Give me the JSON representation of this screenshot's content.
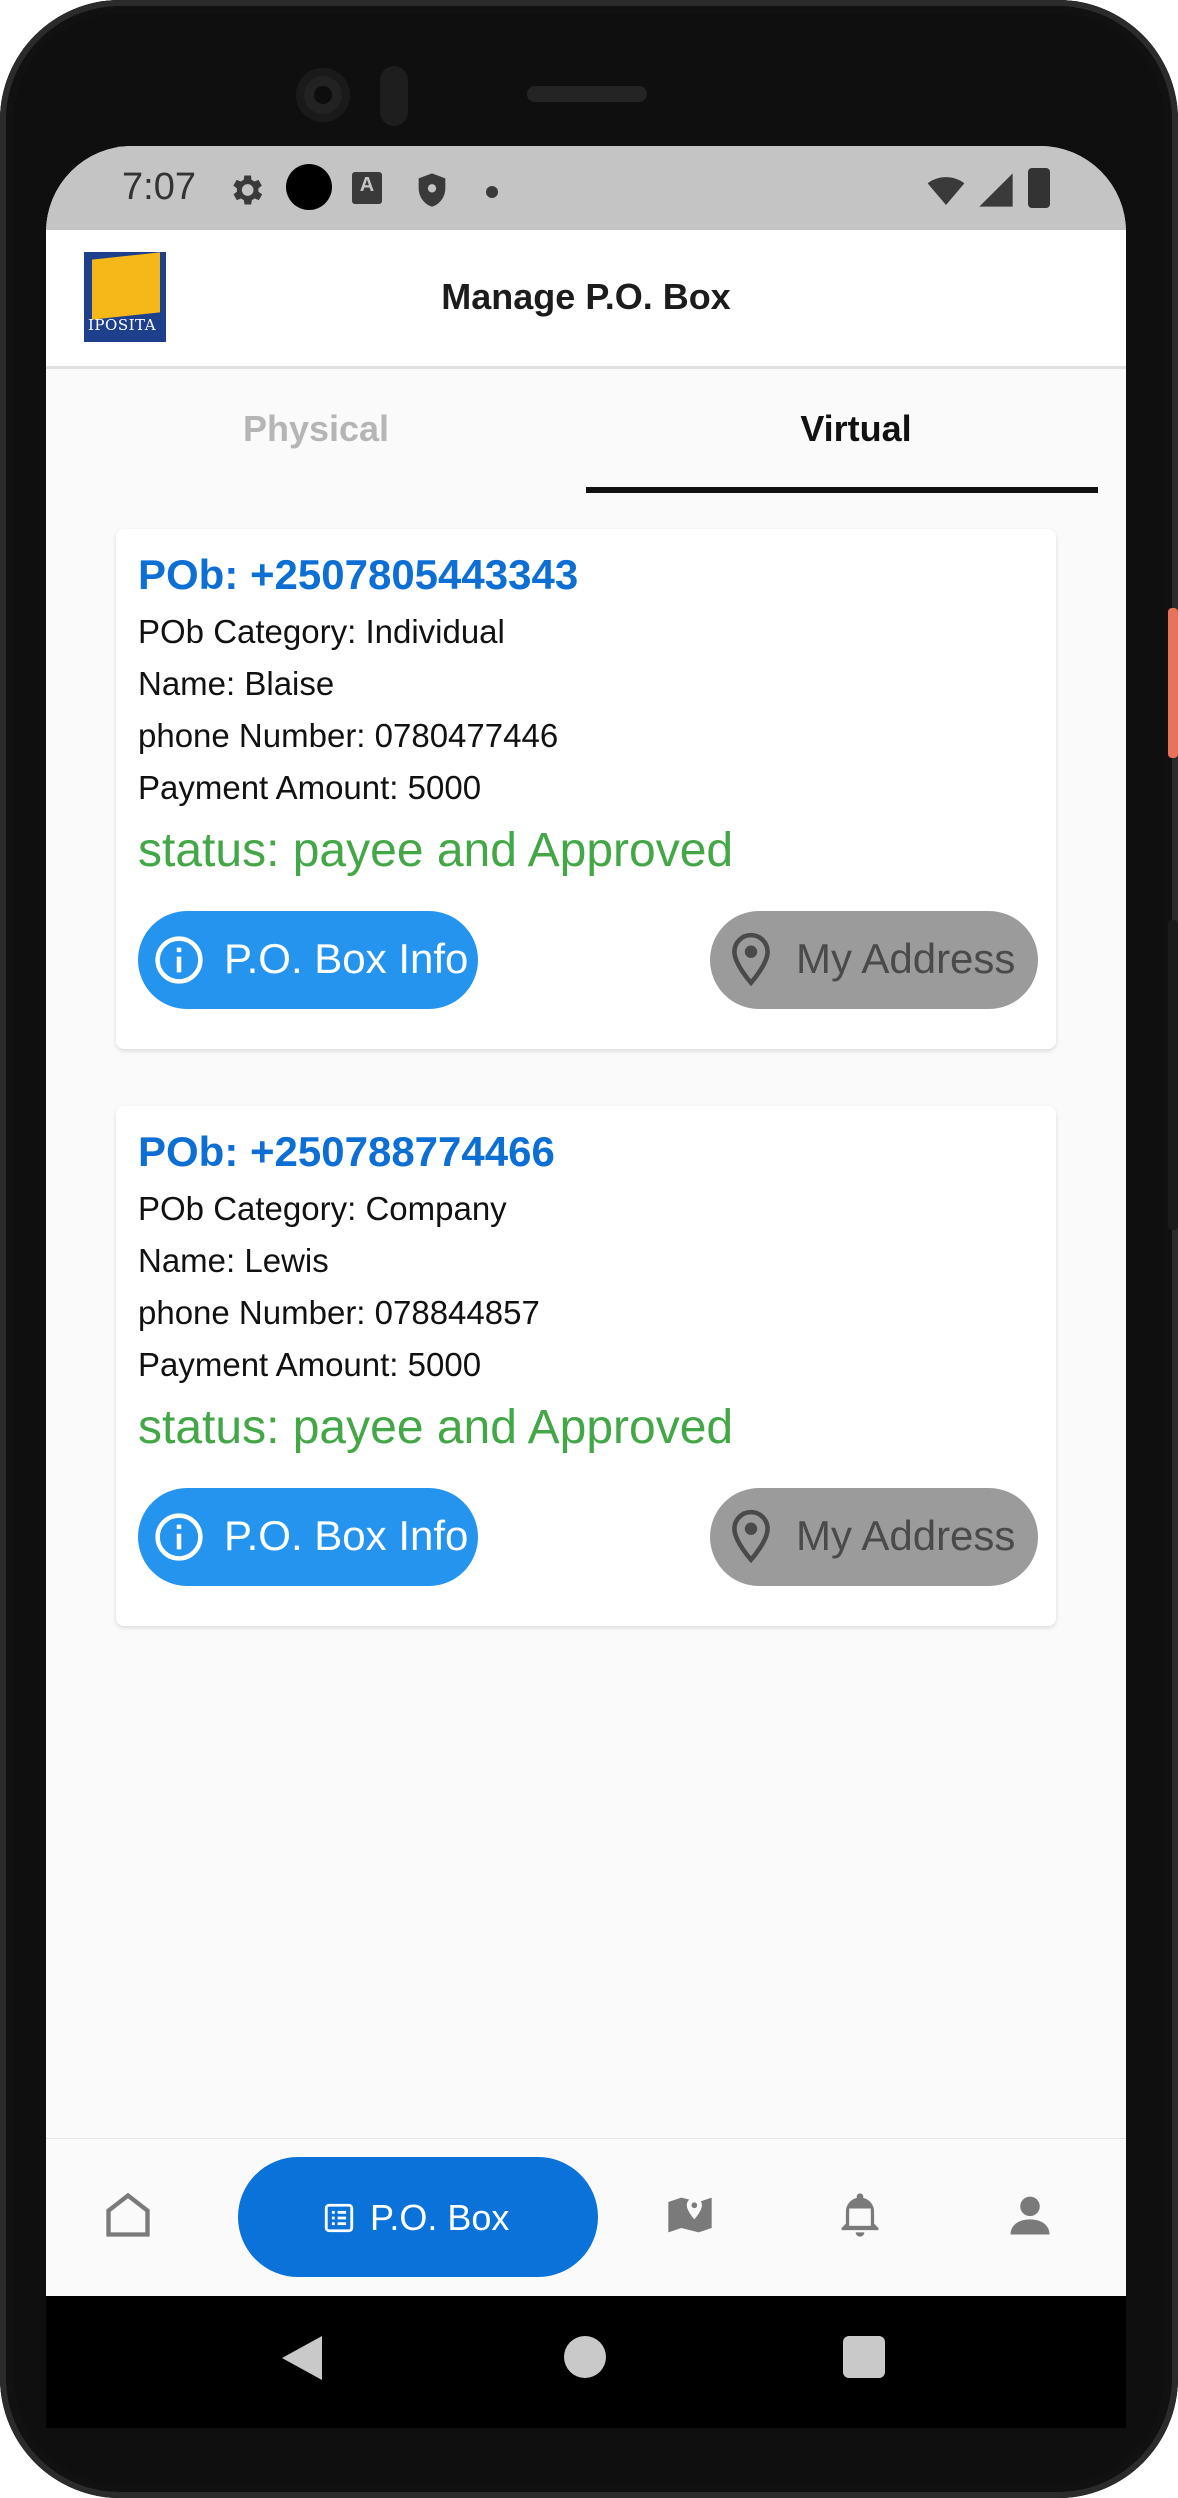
{
  "status_bar": {
    "time": "7:07",
    "icons": [
      "gear-icon",
      "camera-dot-icon",
      "text-a-icon",
      "shield-icon",
      "dot-icon",
      "wifi-icon",
      "signal-icon",
      "battery-icon"
    ],
    "a_glyph": "A"
  },
  "app_bar": {
    "title": "Manage P.O. Box",
    "logo_text": "IPOSITA"
  },
  "tabs": [
    {
      "label": "Physical",
      "active": false
    },
    {
      "label": "Virtual",
      "active": true
    }
  ],
  "cards": [
    {
      "title": "POb: +2507805443343",
      "category": "POb Category: Individual",
      "name": "Name: Blaise",
      "phone": "phone Number: 0780477446",
      "payment": "Payment Amount: 5000",
      "status": "status: payee and  Approved",
      "info_button": "P.O. Box Info",
      "address_button": "My Address"
    },
    {
      "title": "POb: +250788774466",
      "category": "POb Category: Company",
      "name": "Name: Lewis",
      "phone": "phone Number: 078844857",
      "payment": "Payment Amount: 5000",
      "status": "status: payee and  Approved",
      "info_button": "P.O. Box Info",
      "address_button": "My Address"
    }
  ],
  "bottom_nav": {
    "active_label": "P.O. Box",
    "items": [
      "home-icon",
      "list-icon",
      "map-icon",
      "bell-icon",
      "person-icon"
    ]
  },
  "colors": {
    "accent_blue": "#0a72d8",
    "button_blue": "#2494ef",
    "title_blue": "#0d6fd3",
    "status_green": "#43a747",
    "disabled_gray": "#9b9b9b"
  }
}
